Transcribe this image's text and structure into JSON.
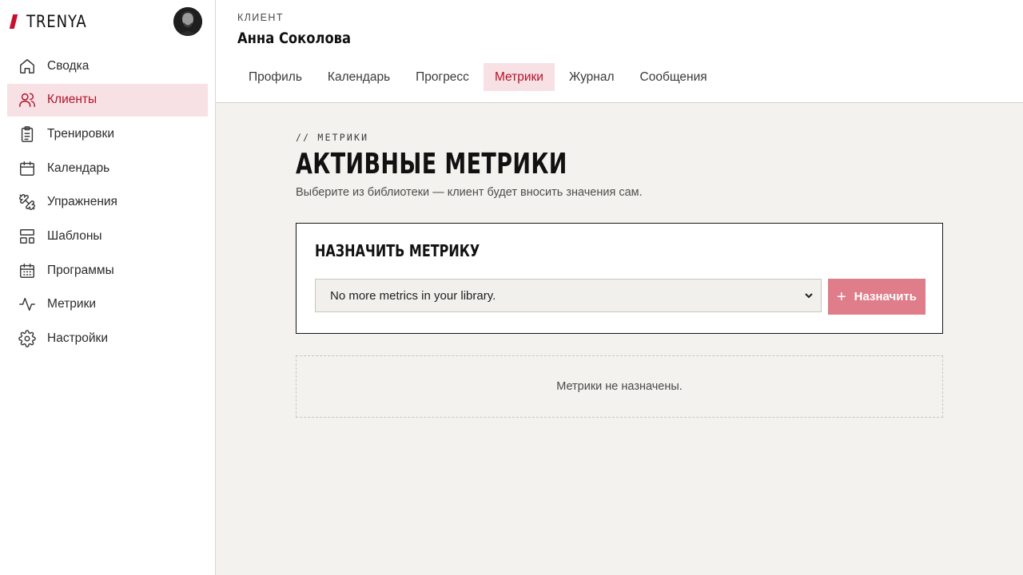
{
  "brand": {
    "name": "TRENYA",
    "accent": "#c8102e"
  },
  "sidebar": {
    "items": [
      {
        "label": "Сводка",
        "icon": "home-icon",
        "active": false
      },
      {
        "label": "Клиенты",
        "icon": "users-icon",
        "active": true
      },
      {
        "label": "Тренировки",
        "icon": "clipboard-list-icon",
        "active": false
      },
      {
        "label": "Календарь",
        "icon": "calendar-icon",
        "active": false
      },
      {
        "label": "Упражнения",
        "icon": "dumbbell-icon",
        "active": false
      },
      {
        "label": "Шаблоны",
        "icon": "layout-template-icon",
        "active": false
      },
      {
        "label": "Программы",
        "icon": "calendar-grid-icon",
        "active": false
      },
      {
        "label": "Метрики",
        "icon": "activity-icon",
        "active": false
      },
      {
        "label": "Настройки",
        "icon": "gear-icon",
        "active": false
      }
    ]
  },
  "header": {
    "caption": "КЛИЕНТ",
    "client_name": "Анна Соколова",
    "tabs": [
      {
        "label": "Профиль",
        "active": false
      },
      {
        "label": "Календарь",
        "active": false
      },
      {
        "label": "Прогресс",
        "active": false
      },
      {
        "label": "Метрики",
        "active": true
      },
      {
        "label": "Журнал",
        "active": false
      },
      {
        "label": "Сообщения",
        "active": false
      }
    ]
  },
  "main": {
    "section_tag": "// МЕТРИКИ",
    "title": "АКТИВНЫЕ МЕТРИКИ",
    "subtitle": "Выберите из библиотеки — клиент будет вносить значения сам.",
    "assign_card": {
      "title": "НАЗНАЧИТЬ МЕТРИКУ",
      "select_value": "No more metrics in your library.",
      "button_icon": "plus-icon",
      "button_label": "Назначить"
    },
    "empty_state": "Метрики не назначены."
  },
  "colors": {
    "accent": "#c8102e",
    "active_bg": "#f7e1e4",
    "active_text": "#b3132b",
    "button_disabled": "#e07d8a",
    "page_bg": "#f3f2ef"
  }
}
